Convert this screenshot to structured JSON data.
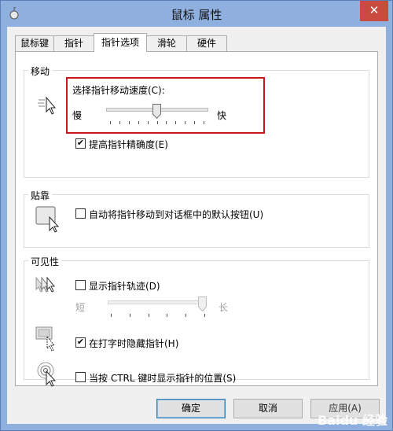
{
  "window": {
    "title": "鼠标 属性",
    "close_symbol": "✕"
  },
  "tabs": [
    {
      "label": "鼠标键",
      "active": false
    },
    {
      "label": "指针",
      "active": false
    },
    {
      "label": "指针选项",
      "active": true
    },
    {
      "label": "滑轮",
      "active": false
    },
    {
      "label": "硬件",
      "active": false
    }
  ],
  "motion": {
    "group_title": "移动",
    "speed_label": "选择指针移动速度(C):",
    "slow_label": "慢",
    "fast_label": "快",
    "speed_value": 6,
    "speed_max": 11,
    "enhance_precision": {
      "label": "提高指针精确度(E)",
      "checked": true
    },
    "highlight_color": "#c8161d"
  },
  "snap_to": {
    "group_title": "贴靠",
    "checkbox": {
      "label": "自动将指针移动到对话框中的默认按钮(U)",
      "checked": false
    }
  },
  "visibility": {
    "group_title": "可见性",
    "trails": {
      "label": "显示指针轨迹(D)",
      "checked": false
    },
    "short_label": "短",
    "long_label": "长",
    "trail_value": 1.0,
    "hide_typing": {
      "label": "在打字时隐藏指针(H)",
      "checked": true
    },
    "show_location": {
      "label": "当按 CTRL 键时显示指针的位置(S)",
      "checked": false
    }
  },
  "buttons": {
    "ok": "确定",
    "cancel": "取消",
    "apply": "应用(A)"
  },
  "watermark": "Baidu 经验",
  "check_symbol": "✔"
}
